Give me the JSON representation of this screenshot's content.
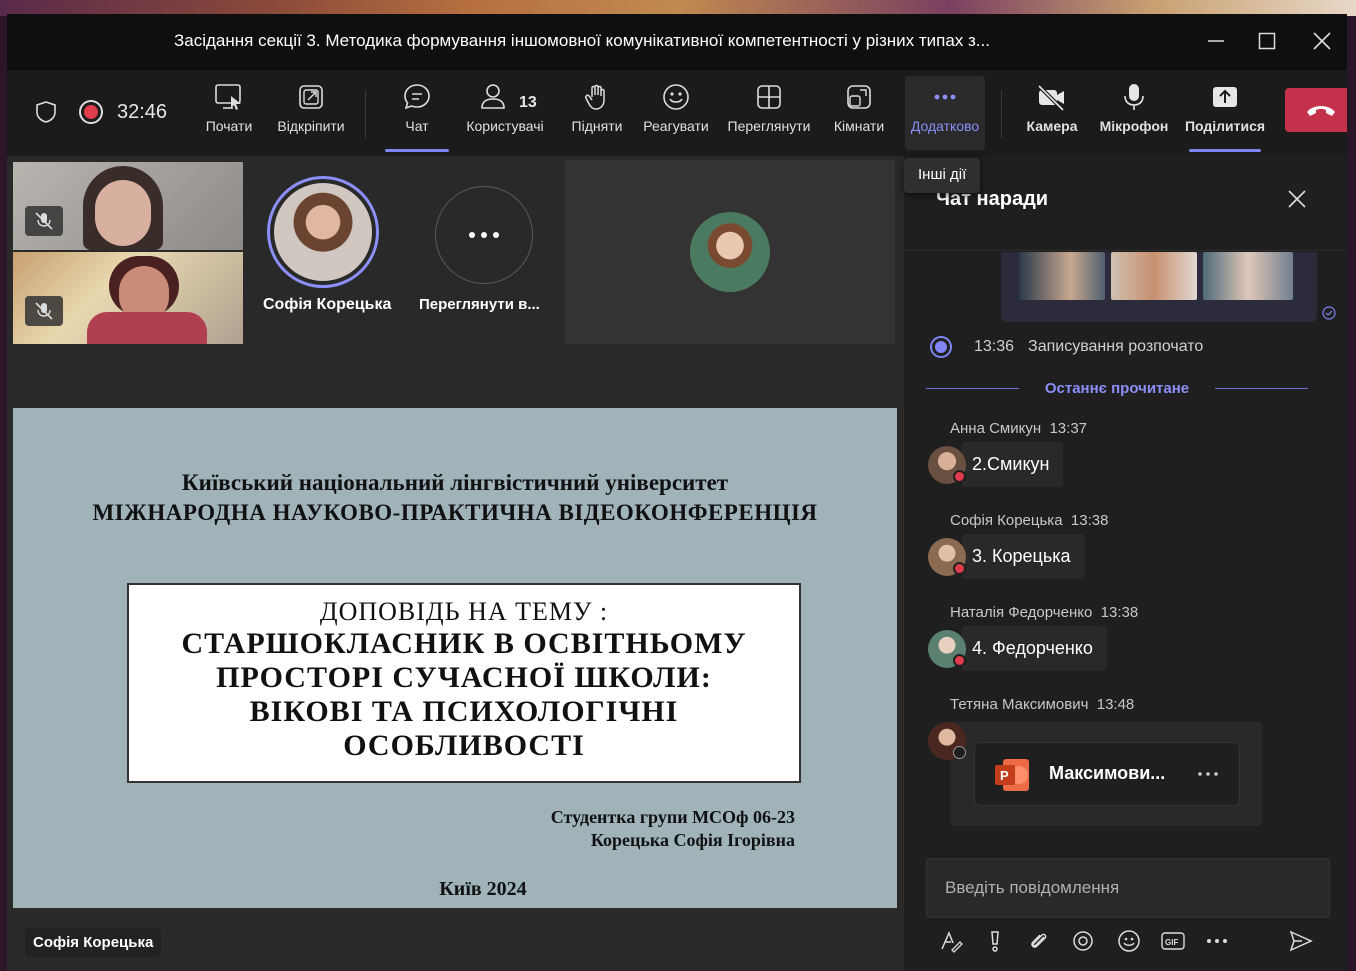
{
  "window": {
    "title": "Засідання секції 3. Методика формування іншомовної комунікативної компетентності у різних типах з...",
    "controls": [
      "minimize",
      "maximize",
      "close"
    ]
  },
  "toolbar": {
    "timer": "32:46",
    "items": [
      {
        "label": "Почати",
        "icon": "present-screen-icon"
      },
      {
        "label": "Відкріпити",
        "icon": "popout-icon"
      },
      {
        "label": "Чат",
        "icon": "chat-icon",
        "active": true
      },
      {
        "label": "Користувачі",
        "icon": "people-icon",
        "badge": "13"
      },
      {
        "label": "Підняти",
        "icon": "raise-hand-icon"
      },
      {
        "label": "Реагувати",
        "icon": "emoji-icon"
      },
      {
        "label": "Переглянути",
        "icon": "grid-view-icon"
      },
      {
        "label": "Кімнати",
        "icon": "rooms-icon"
      },
      {
        "label": "Додатково",
        "icon": "more-icon",
        "highlighted": true
      },
      {
        "label": "Камера",
        "icon": "camera-off-icon"
      },
      {
        "label": "Мікрофон",
        "icon": "microphone-icon"
      },
      {
        "label": "Поділитися",
        "icon": "share-icon",
        "active": true
      }
    ],
    "more_tooltip": "Інші дії"
  },
  "stage": {
    "participant_featured": "Софія Корецька",
    "view_more": "Переглянути в...",
    "presenter_tag": "Софія Корецька"
  },
  "slide": {
    "university": "Київський національний лінгвістичний університет",
    "conference": "МІЖНАРОДНА НАУКОВО-ПРАКТИЧНА ВІДЕОКОНФЕРЕНЦІЯ",
    "subtitle": "ДОПОВІДЬ НА ТЕМУ :",
    "topic_lines": [
      "СТАРШОКЛАСНИК В ОСВІТНЬОМУ",
      "ПРОСТОРІ СУЧАСНОЇ ШКОЛИ:",
      "ВІКОВІ ТА ПСИХОЛОГІЧНІ",
      "ОСОБЛИВОСТІ"
    ],
    "student_line1": "Студентка групи МСОф 06-23",
    "student_line2": "Корецька Софія Ігорівна",
    "city_year": "Київ 2024"
  },
  "chat": {
    "title": "Чат наради",
    "recording": {
      "time": "13:36",
      "text": "Записування розпочато"
    },
    "last_read": "Останнє прочитане",
    "messages": [
      {
        "author": "Анна Смикун",
        "time": "13:37",
        "text": "2.Смикун"
      },
      {
        "author": "Софія Корецька",
        "time": "13:38",
        "text": "3. Корецька"
      },
      {
        "author": "Наталія Федорченко",
        "time": "13:38",
        "text": "4. Федорченко"
      },
      {
        "author": "Тетяна Максимович",
        "time": "13:48",
        "file": "Максимови..."
      }
    ],
    "composer_placeholder": "Введіть повідомлення"
  },
  "colors": {
    "accent": "#7f85f5",
    "leave": "#c4314b",
    "slide_bg": "#9fb3b9"
  }
}
